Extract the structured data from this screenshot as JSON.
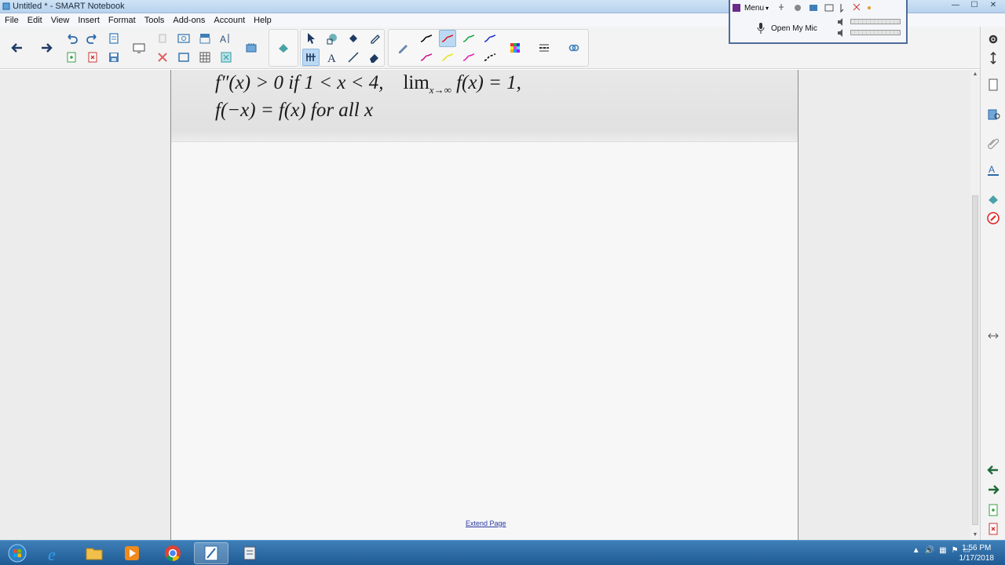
{
  "window": {
    "title": "Untitled * - SMART Notebook",
    "min": "—",
    "max": "☐",
    "close": "✕"
  },
  "menu": [
    "File",
    "Edit",
    "View",
    "Insert",
    "Format",
    "Tools",
    "Add-ons",
    "Account",
    "Help"
  ],
  "toolbar": {
    "nav_icons": [
      "back-arrow-icon",
      "forward-arrow-icon"
    ],
    "edit_icons": [
      "undo-icon",
      "redo-icon",
      "paste-icon",
      "add-page-icon",
      "delete-page-icon",
      "save-icon",
      "screen-shade-icon",
      "delete-icon",
      "capture-icon",
      "fullscreen-icon",
      "table-icon",
      "clear-icon",
      "record-icon",
      "text-recognition-icon",
      "document-camera-icon"
    ],
    "tool_icons": [
      "select-icon",
      "shapes-icon",
      "fill-icon",
      "magic-pen-icon",
      "table-tool-icon",
      "text-icon",
      "line-icon",
      "eraser-icon"
    ],
    "pen_colors": [
      "#000000",
      "#e0141e",
      "#10a63b",
      "#1a2ccf",
      "#cc0e8f",
      "#e6e31a",
      "#e61ab3",
      "#000000"
    ],
    "active_pen_index": 1,
    "accent": "#3a86c8"
  },
  "audio_panel": {
    "menu_label": "Menu",
    "mic_label": "Open My Mic"
  },
  "page": {
    "math_line1_a": "f″(x) > 0 if 1 < x < 4,",
    "math_line1_lim": "lim",
    "math_line1_sub": "x→∞",
    "math_line1_b": "f(x) = 1,",
    "math_line2": "f(−x) = f(x) for all x",
    "extend_link": "Extend Page"
  },
  "sidebar": {
    "icons": [
      "page-sorter-icon",
      "gallery-icon",
      "attachments-icon",
      "properties-icon",
      "addons-icon",
      "smart-ink-icon",
      "move-sidebar-icon",
      "prev-page-icon",
      "next-page-icon",
      "add-page-icon",
      "delete-page-icon"
    ]
  },
  "taskbar": {
    "apps": [
      "start-orb-icon",
      "internet-explorer-icon",
      "file-explorer-icon",
      "media-player-icon",
      "chrome-icon",
      "smart-notebook-icon",
      "presentation-tool-icon"
    ],
    "active_index": 5,
    "time": "1:56 PM",
    "date": "1/17/2018"
  }
}
